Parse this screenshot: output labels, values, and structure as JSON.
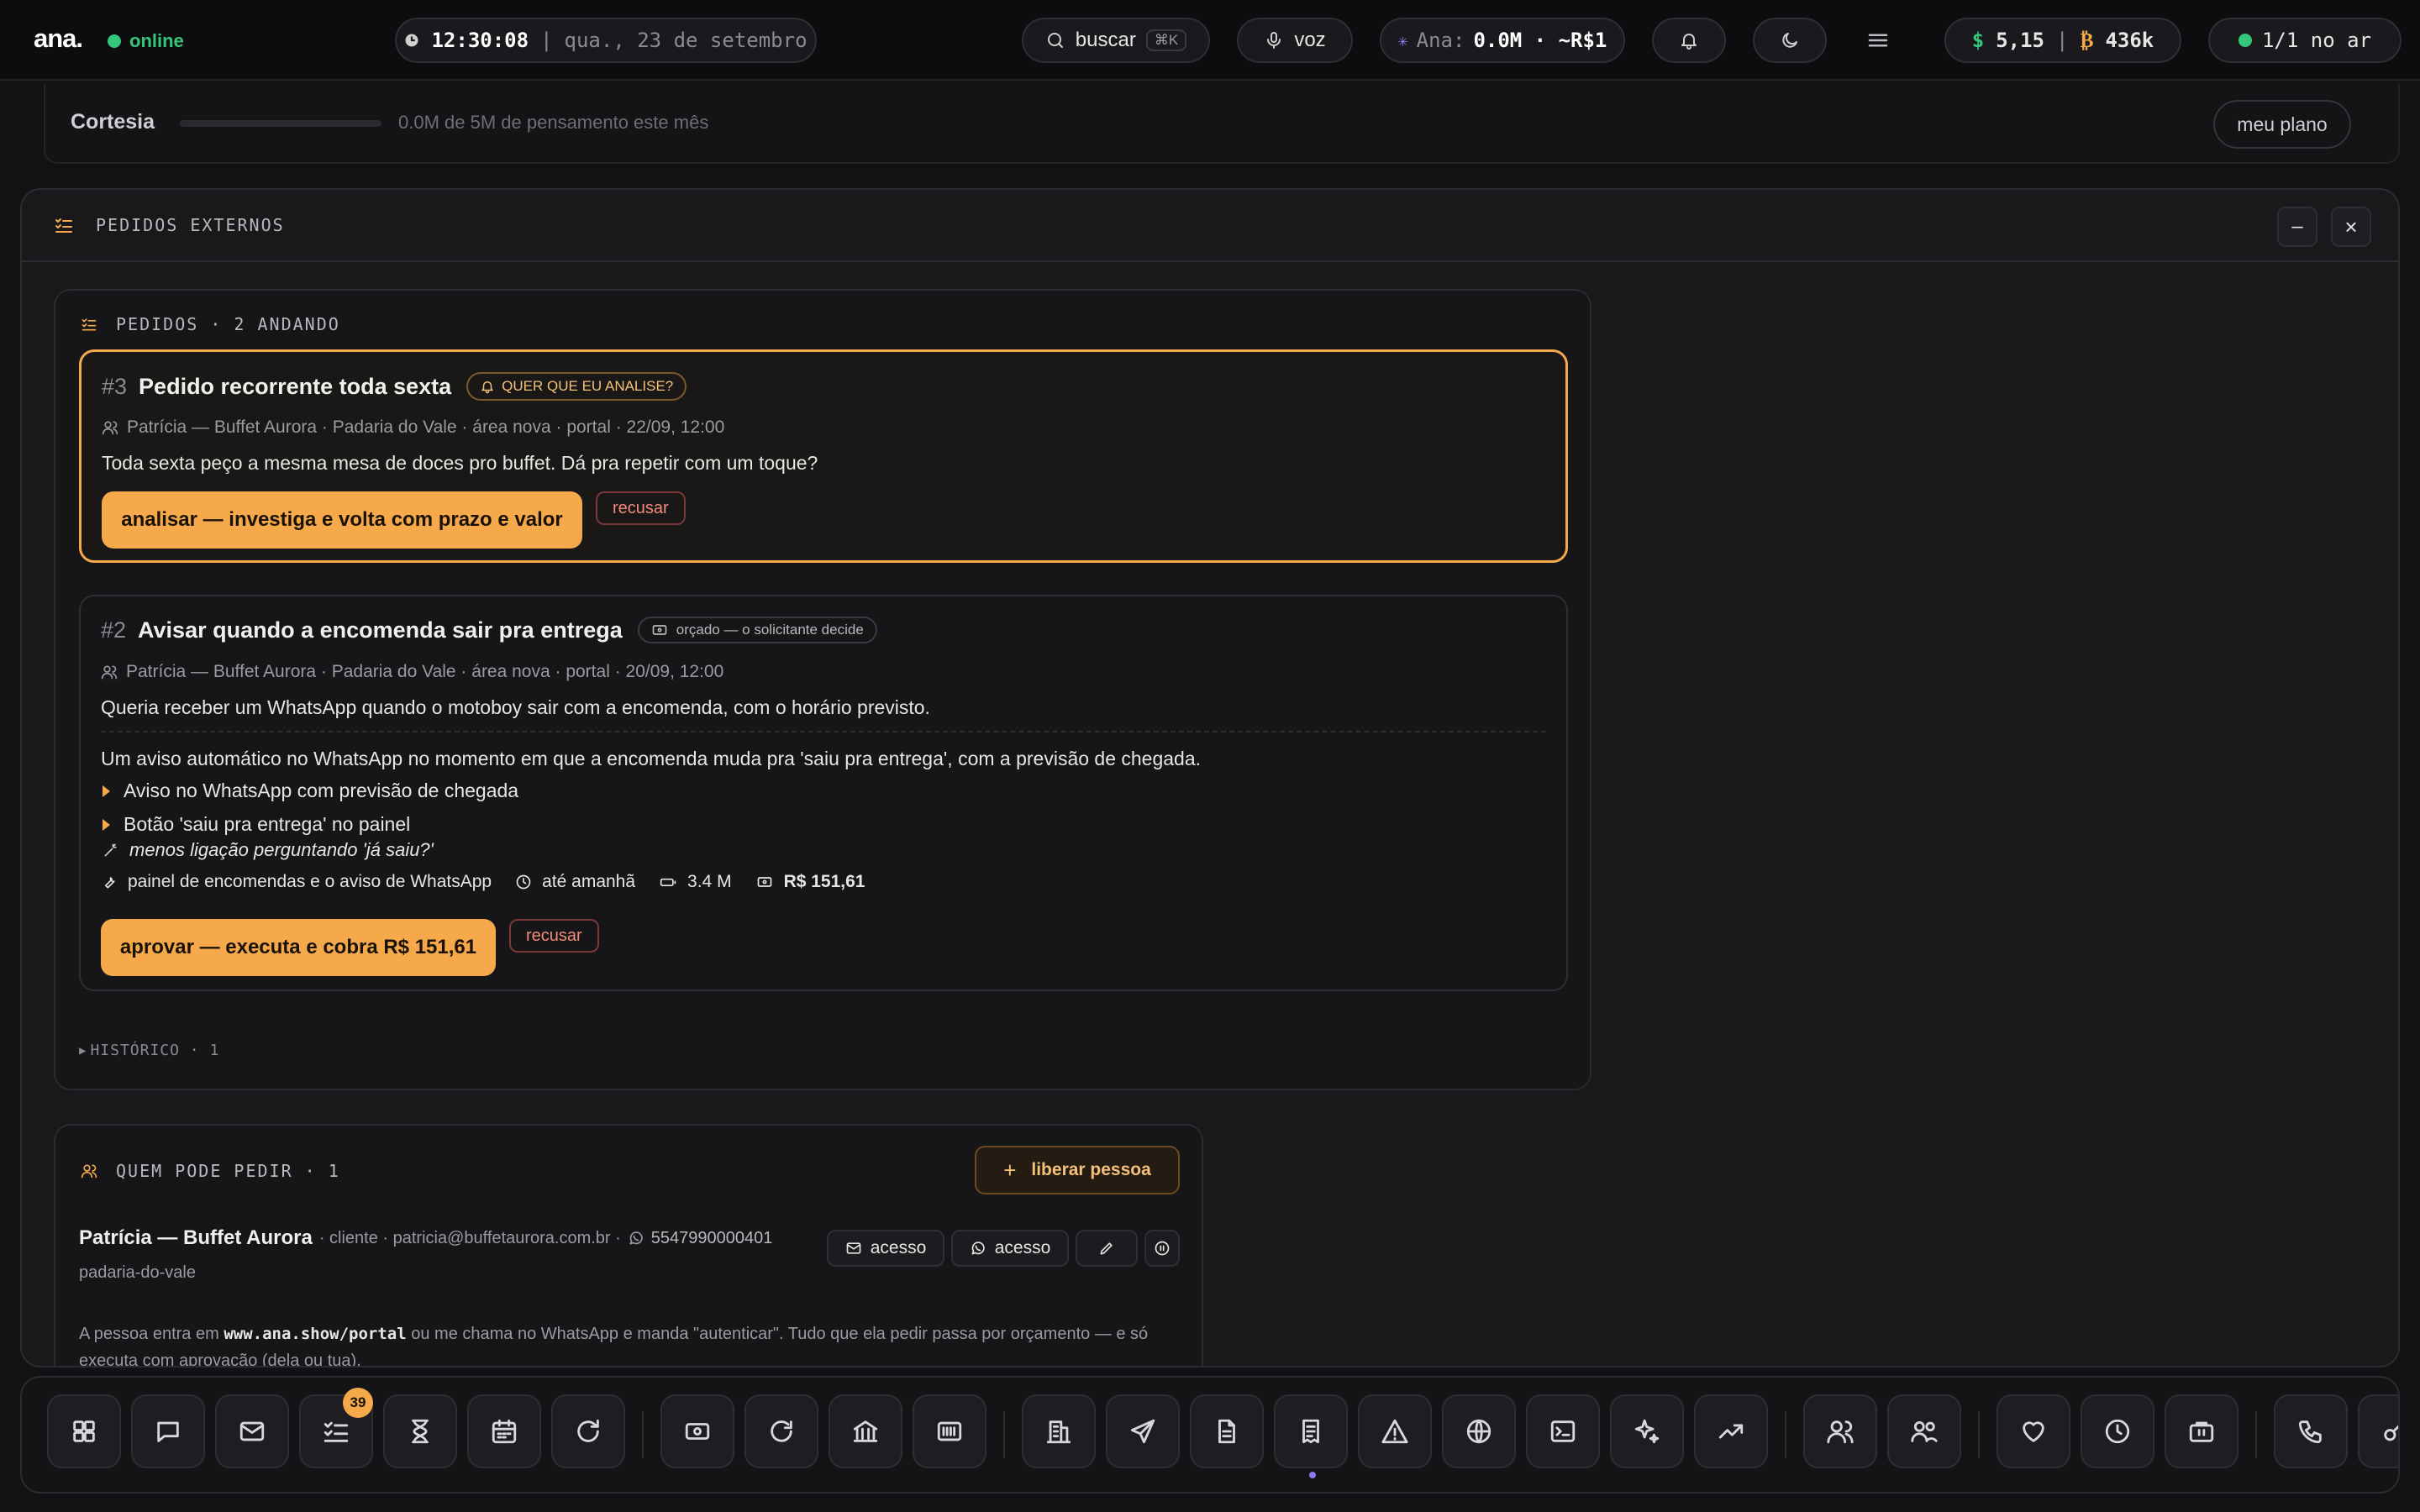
{
  "topbar": {
    "logo": "ana.",
    "status": "online",
    "time": "12:30:08",
    "separator": "|",
    "date": "qua., 23 de setembro",
    "search_label": "buscar",
    "search_shortcut": "⌘K",
    "voice_label": "voz",
    "ana_label": "Ana:",
    "ana_usage": "0.0M · ~R$1",
    "balance_usd_symbol": "$",
    "balance_usd": "5,15",
    "balance_sep": "|",
    "balance_btc_symbol": "₿",
    "balance_btc": "436k",
    "live": "1/1 no ar"
  },
  "cortesia": {
    "label": "Cortesia",
    "progress_text": "0.0M de 5M de pensamento este mês",
    "progress": 0.0,
    "plan_button": "meu plano"
  },
  "panel": {
    "title": "PEDIDOS EXTERNOS",
    "minimize": "–",
    "close": "×",
    "orders": {
      "header": "PEDIDOS · 2 ANDANDO",
      "items": [
        {
          "number": "#3",
          "title": "Pedido recorrente toda sexta",
          "tag": "QUER QUE EU ANALISE?",
          "meta": "Patrícia — Buffet Aurora · Padaria do Vale · área nova · portal · 22/09, 12:00",
          "description": "Toda sexta peço a mesma mesa de doces pro buffet. Dá pra repetir com um toque?",
          "primary_action": "analisar — investiga e volta com prazo e valor",
          "reject": "recusar"
        },
        {
          "number": "#2",
          "title": "Avisar quando a encomenda sair pra entrega",
          "tag": "orçado — o solicitante decide",
          "meta": "Patrícia — Buffet Aurora · Padaria do Vale · área nova · portal · 20/09, 12:00",
          "description": "Queria receber um WhatsApp quando o motoboy sair com a encomenda, com o horário previsto.",
          "proposal": "Um aviso automático no WhatsApp no momento em que a encomenda muda pra 'saiu pra entrega', com a previsão de chegada.",
          "bullets": [
            "Aviso no WhatsApp com previsão de chegada",
            "Botão 'saiu pra entrega' no painel"
          ],
          "benefit": "menos ligação perguntando 'já saiu?'",
          "scope": "painel de encomendas e o aviso de WhatsApp",
          "deadline": "até amanhã",
          "tokens": "3.4 M",
          "price": "R$ 151,61",
          "primary_action": "aprovar — executa e cobra R$ 151,61",
          "reject": "recusar"
        }
      ],
      "history": "HISTÓRICO · 1"
    },
    "access": {
      "header": "QUEM PODE PEDIR · 1",
      "add_button": "liberar pessoa",
      "person": {
        "name": "Patrícia — Buffet Aurora",
        "details": "· cliente · patricia@buffetaurora.com.br ·",
        "phone": "5547990000401",
        "slug": "padaria-do-vale",
        "email_access": "acesso",
        "whatsapp_access": "acesso"
      },
      "note_prefix": "A pessoa entra em",
      "note_url": "www.ana.show/portal",
      "note_suffix": "ou me chama no WhatsApp e manda \"autenticar\". Tudo que ela pedir passa por orçamento — e só executa com aprovação (dela ou tua)."
    }
  },
  "dock": {
    "tasks_badge": "39",
    "icons": [
      "grid-icon",
      "chat-icon",
      "mail-icon",
      "tasks-icon",
      "hourglass-icon",
      "calendar-icon",
      "refresh-icon",
      "cash-icon",
      "loop-icon",
      "bank-icon",
      "barcode-icon",
      "building-icon",
      "send-icon",
      "document-icon",
      "receipt-icon",
      "warning-icon",
      "globe-icon",
      "terminal-icon",
      "sparkle-icon",
      "trend-icon",
      "contacts-icon",
      "team-icon",
      "heart-icon",
      "clock-icon",
      "briefcase-icon",
      "phone-icon",
      "key-icon"
    ]
  },
  "colors": {
    "accent": "#f5a94a",
    "online": "#34c77b",
    "danger": "#f08a7a"
  }
}
